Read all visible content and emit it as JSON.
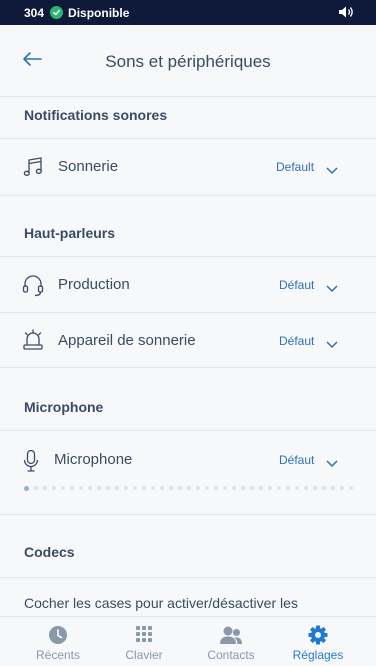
{
  "status": {
    "extension": "304",
    "availability": "Disponible"
  },
  "header": {
    "title": "Sons et périphériques"
  },
  "sections": {
    "notifications": "Notifications sonores",
    "speakers": "Haut-parleurs",
    "microphone": "Microphone",
    "codecs": "Codecs"
  },
  "rows": {
    "ringtone": {
      "label": "Sonnerie",
      "value": "Default"
    },
    "production": {
      "label": "Production",
      "value": "Défaut"
    },
    "ring_device": {
      "label": "Appareil de sonnerie",
      "value": "Défaut"
    },
    "microphone": {
      "label": "Microphone",
      "value": "Défaut"
    }
  },
  "mic_level": 0.02,
  "codecs_text": "Cocher les cases pour activer/désactiver les",
  "tabs": [
    {
      "label": "Récents",
      "icon": "clock-icon",
      "active": false
    },
    {
      "label": "Clavier",
      "icon": "keypad-icon",
      "active": false
    },
    {
      "label": "Contacts",
      "icon": "contacts-icon",
      "active": false
    },
    {
      "label": "Réglages",
      "icon": "gear-icon",
      "active": true
    }
  ],
  "colors": {
    "status_bar": "#0f1a3a",
    "available": "#2bb673",
    "accent": "#1f7ad1",
    "value": "#2f6fb3"
  }
}
